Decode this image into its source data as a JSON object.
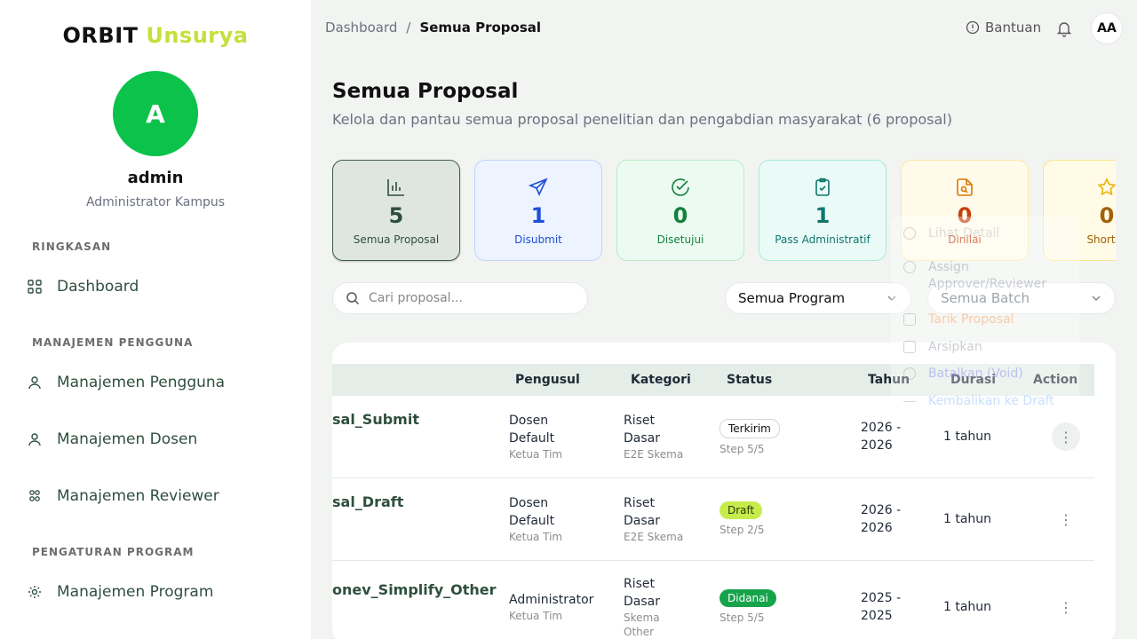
{
  "brand": {
    "part1": "ORBIT",
    "part2": "Unsurya"
  },
  "profile": {
    "initial": "A",
    "name": "admin",
    "role": "Administrator Kampus"
  },
  "sidebar": {
    "sections": [
      {
        "label": "RINGKASAN"
      },
      {
        "label": "MANAJEMEN PENGGUNA"
      },
      {
        "label": "PENGATURAN PROGRAM"
      }
    ],
    "items": [
      {
        "label": "Dashboard",
        "icon": "grid-icon"
      },
      {
        "label": "Manajemen Pengguna",
        "icon": "user-icon"
      },
      {
        "label": "Manajemen Dosen",
        "icon": "user-icon"
      },
      {
        "label": "Manajemen Reviewer",
        "icon": "users-icon"
      },
      {
        "label": "Manajemen Program",
        "icon": "gear-icon"
      }
    ]
  },
  "header": {
    "breadcrumb": {
      "root": "Dashboard",
      "sep": "/",
      "current": "Semua Proposal"
    },
    "help_label": "Bantuan",
    "avatar_initials": "AA"
  },
  "page": {
    "title": "Semua Proposal",
    "subtitle": "Kelola dan pantau semua proposal penelitian dan pengabdian masyarakat (6 proposal)"
  },
  "stats": [
    {
      "value": "5",
      "label": "Semua Proposal",
      "icon": "bar-chart-icon",
      "color": "#2f4f3e"
    },
    {
      "value": "1",
      "label": "Disubmit",
      "icon": "send-icon",
      "color": "#1d4ed8"
    },
    {
      "value": "0",
      "label": "Disetujui",
      "icon": "check-circle-icon",
      "color": "#15803d"
    },
    {
      "value": "1",
      "label": "Pass Administratif",
      "icon": "clipboard-check-icon",
      "color": "#0f766e"
    },
    {
      "value": "0",
      "label": "Dinilai",
      "icon": "file-search-icon",
      "color": "#c2410c"
    },
    {
      "value": "0",
      "label": "Shortlis",
      "icon": "star-icon",
      "color": "#a16207"
    }
  ],
  "filters": {
    "search_placeholder": "Cari proposal...",
    "program_value": "Semua Program",
    "batch_value": "Semua Batch"
  },
  "table": {
    "headers": {
      "pengusul": "Pengusul",
      "kategori": "Kategori",
      "status": "Status",
      "tahun": "Tahun",
      "durasi": "Durasi",
      "action": "Action"
    },
    "rows": [
      {
        "title": "sal_Submit",
        "pengusul": "Dosen Default",
        "pengusul_line1": "Dosen",
        "pengusul_line2": "Default",
        "pengusul_role": "Ketua Tim",
        "kategori_line1": "Riset",
        "kategori_line2": "Dasar",
        "skema": "E2E Skema",
        "status": "Terkirim",
        "step": "Step 5/5",
        "tahun_line1": "2026 -",
        "tahun_line2": "2026",
        "durasi": "1 tahun"
      },
      {
        "title": "sal_Draft",
        "pengusul_line1": "Dosen",
        "pengusul_line2": "Default",
        "pengusul_role": "Ketua Tim",
        "kategori_line1": "Riset",
        "kategori_line2": "Dasar",
        "skema": "E2E Skema",
        "status": "Draft",
        "step": "Step 2/5",
        "tahun_line1": "2026 -",
        "tahun_line2": "2026",
        "durasi": "1 tahun"
      },
      {
        "title": "onev_Simplify_Other",
        "pengusul_line1": "Administrator",
        "pengusul_role": "Ketua Tim",
        "kategori_line1": "Riset",
        "kategori_line2": "Dasar",
        "skema_line1": "Skema",
        "skema_line2": "Other",
        "status": "Didanai",
        "step": "Step 5/5",
        "tahun_line1": "2025 -",
        "tahun_line2": "2025",
        "durasi": "1 tahun"
      }
    ]
  },
  "action_menu": {
    "items": [
      "Lihat Detail",
      "Assign Approver/Reviewer",
      "Tarik Proposal",
      "Arsipkan",
      "Batalkan (Void)",
      "Kembalikan ke Draft"
    ],
    "colors": [
      "#9ca3af",
      "#6b7280",
      "#f97316",
      "#6b7280",
      "#6366f1",
      "#60a5fa"
    ]
  }
}
